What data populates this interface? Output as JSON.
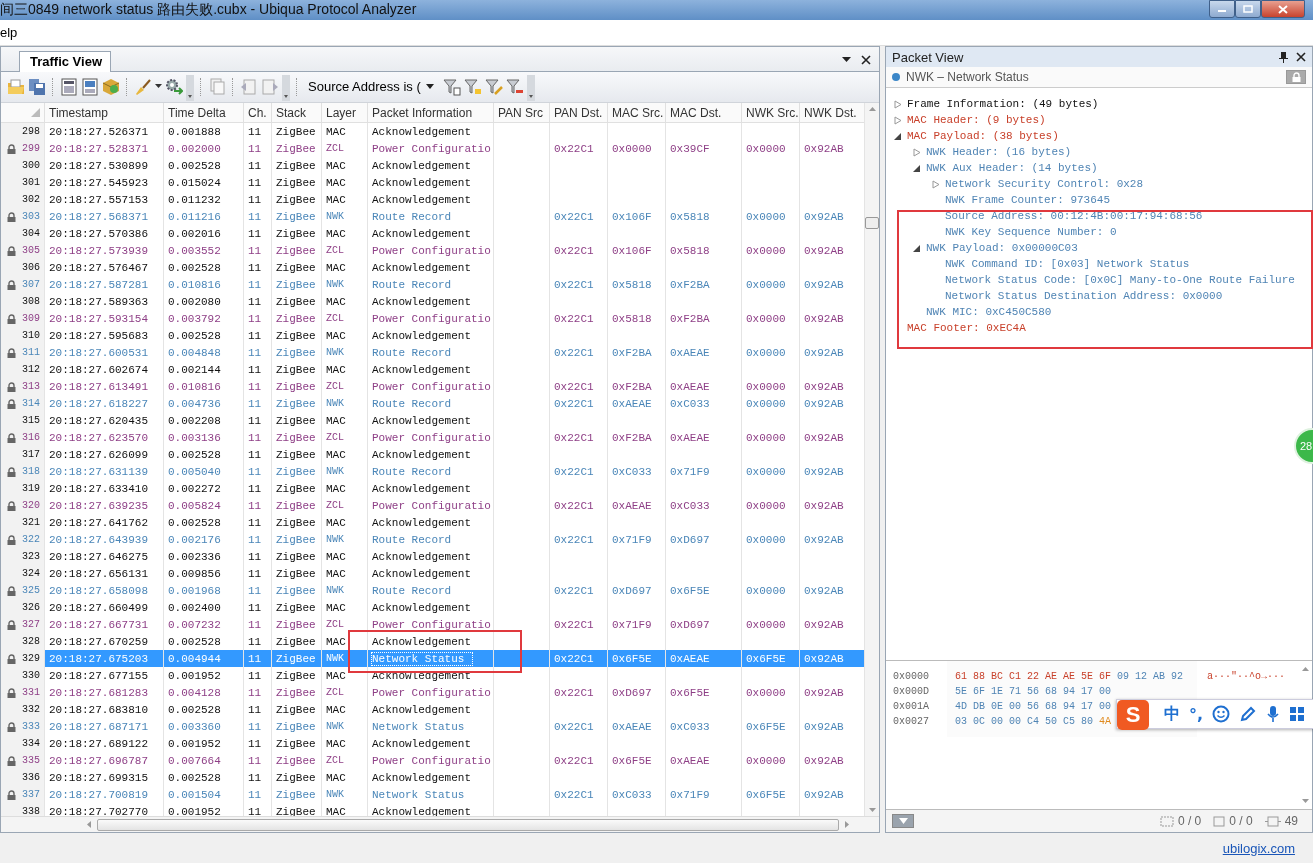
{
  "window": {
    "title": "间三0849 network status 路由失败.cubx - Ubiqua Protocol Analyzer"
  },
  "menu": [
    "elp"
  ],
  "traffic_view": {
    "tab": {
      "label": "Traffic View",
      "selected": true
    },
    "filter": "Source Address is (",
    "columns": [
      "Timestamp",
      "Time Delta",
      "Ch.",
      "Stack",
      "Layer",
      "Packet Information",
      "PAN Src",
      "PAN Dst.",
      "MAC Src.",
      "MAC Dst.",
      "NWK Src.",
      "NWK Dst."
    ],
    "rows": [
      {
        "n": "298",
        "timestamp": "20:18:27.526371",
        "time_delta": "0.001888",
        "ch": "11",
        "stack": "ZigBee",
        "layer": "MAC",
        "info": "Acknowledgement",
        "kind": "ack",
        "locked": false,
        "selected": false
      },
      {
        "n": "299",
        "timestamp": "20:18:27.528371",
        "time_delta": "0.002000",
        "ch": "11",
        "stack": "ZigBee",
        "layer": "ZCL",
        "info": "Power Configuratio",
        "pan_dst": "0x22C1",
        "mac_src": "0x0000",
        "mac_dst": "0x39CF",
        "nwk_src": "0x0000",
        "nwk_dst": "0x92AB",
        "kind": "zcl",
        "locked": true,
        "selected": false
      },
      {
        "n": "300",
        "timestamp": "20:18:27.530899",
        "time_delta": "0.002528",
        "ch": "11",
        "stack": "ZigBee",
        "layer": "MAC",
        "info": "Acknowledgement",
        "kind": "ack",
        "locked": false,
        "selected": false
      },
      {
        "n": "301",
        "timestamp": "20:18:27.545923",
        "time_delta": "0.015024",
        "ch": "11",
        "stack": "ZigBee",
        "layer": "MAC",
        "info": "Acknowledgement",
        "kind": "ack",
        "locked": false,
        "selected": false
      },
      {
        "n": "302",
        "timestamp": "20:18:27.557153",
        "time_delta": "0.011232",
        "ch": "11",
        "stack": "ZigBee",
        "layer": "MAC",
        "info": "Acknowledgement",
        "kind": "ack",
        "locked": false,
        "selected": false
      },
      {
        "n": "303",
        "timestamp": "20:18:27.568371",
        "time_delta": "0.011216",
        "ch": "11",
        "stack": "ZigBee",
        "layer": "NWK",
        "info": "Route Record",
        "pan_dst": "0x22C1",
        "mac_src": "0x106F",
        "mac_dst": "0x5818",
        "nwk_src": "0x0000",
        "nwk_dst": "0x92AB",
        "kind": "nwk",
        "locked": true,
        "selected": false
      },
      {
        "n": "304",
        "timestamp": "20:18:27.570386",
        "time_delta": "0.002016",
        "ch": "11",
        "stack": "ZigBee",
        "layer": "MAC",
        "info": "Acknowledgement",
        "kind": "ack",
        "locked": false,
        "selected": false
      },
      {
        "n": "305",
        "timestamp": "20:18:27.573939",
        "time_delta": "0.003552",
        "ch": "11",
        "stack": "ZigBee",
        "layer": "ZCL",
        "info": "Power Configuratio",
        "pan_dst": "0x22C1",
        "mac_src": "0x106F",
        "mac_dst": "0x5818",
        "nwk_src": "0x0000",
        "nwk_dst": "0x92AB",
        "kind": "zcl",
        "locked": true,
        "selected": false
      },
      {
        "n": "306",
        "timestamp": "20:18:27.576467",
        "time_delta": "0.002528",
        "ch": "11",
        "stack": "ZigBee",
        "layer": "MAC",
        "info": "Acknowledgement",
        "kind": "ack",
        "locked": false,
        "selected": false
      },
      {
        "n": "307",
        "timestamp": "20:18:27.587281",
        "time_delta": "0.010816",
        "ch": "11",
        "stack": "ZigBee",
        "layer": "NWK",
        "info": "Route Record",
        "pan_dst": "0x22C1",
        "mac_src": "0x5818",
        "mac_dst": "0xF2BA",
        "nwk_src": "0x0000",
        "nwk_dst": "0x92AB",
        "kind": "nwk",
        "locked": true,
        "selected": false
      },
      {
        "n": "308",
        "timestamp": "20:18:27.589363",
        "time_delta": "0.002080",
        "ch": "11",
        "stack": "ZigBee",
        "layer": "MAC",
        "info": "Acknowledgement",
        "kind": "ack",
        "locked": false,
        "selected": false
      },
      {
        "n": "309",
        "timestamp": "20:18:27.593154",
        "time_delta": "0.003792",
        "ch": "11",
        "stack": "ZigBee",
        "layer": "ZCL",
        "info": "Power Configuratio",
        "pan_dst": "0x22C1",
        "mac_src": "0x5818",
        "mac_dst": "0xF2BA",
        "nwk_src": "0x0000",
        "nwk_dst": "0x92AB",
        "kind": "zcl",
        "locked": true,
        "selected": false
      },
      {
        "n": "310",
        "timestamp": "20:18:27.595683",
        "time_delta": "0.002528",
        "ch": "11",
        "stack": "ZigBee",
        "layer": "MAC",
        "info": "Acknowledgement",
        "kind": "ack",
        "locked": false,
        "selected": false
      },
      {
        "n": "311",
        "timestamp": "20:18:27.600531",
        "time_delta": "0.004848",
        "ch": "11",
        "stack": "ZigBee",
        "layer": "NWK",
        "info": "Route Record",
        "pan_dst": "0x22C1",
        "mac_src": "0xF2BA",
        "mac_dst": "0xAEAE",
        "nwk_src": "0x0000",
        "nwk_dst": "0x92AB",
        "kind": "nwk",
        "locked": true,
        "selected": false
      },
      {
        "n": "312",
        "timestamp": "20:18:27.602674",
        "time_delta": "0.002144",
        "ch": "11",
        "stack": "ZigBee",
        "layer": "MAC",
        "info": "Acknowledgement",
        "kind": "ack",
        "locked": false,
        "selected": false
      },
      {
        "n": "313",
        "timestamp": "20:18:27.613491",
        "time_delta": "0.010816",
        "ch": "11",
        "stack": "ZigBee",
        "layer": "ZCL",
        "info": "Power Configuratio",
        "pan_dst": "0x22C1",
        "mac_src": "0xF2BA",
        "mac_dst": "0xAEAE",
        "nwk_src": "0x0000",
        "nwk_dst": "0x92AB",
        "kind": "zcl",
        "locked": true,
        "selected": false
      },
      {
        "n": "314",
        "timestamp": "20:18:27.618227",
        "time_delta": "0.004736",
        "ch": "11",
        "stack": "ZigBee",
        "layer": "NWK",
        "info": "Route Record",
        "pan_dst": "0x22C1",
        "mac_src": "0xAEAE",
        "mac_dst": "0xC033",
        "nwk_src": "0x0000",
        "nwk_dst": "0x92AB",
        "kind": "nwk",
        "locked": true,
        "selected": false
      },
      {
        "n": "315",
        "timestamp": "20:18:27.620435",
        "time_delta": "0.002208",
        "ch": "11",
        "stack": "ZigBee",
        "layer": "MAC",
        "info": "Acknowledgement",
        "kind": "ack",
        "locked": false,
        "selected": false
      },
      {
        "n": "316",
        "timestamp": "20:18:27.623570",
        "time_delta": "0.003136",
        "ch": "11",
        "stack": "ZigBee",
        "layer": "ZCL",
        "info": "Power Configuratio",
        "pan_dst": "0x22C1",
        "mac_src": "0xF2BA",
        "mac_dst": "0xAEAE",
        "nwk_src": "0x0000",
        "nwk_dst": "0x92AB",
        "kind": "zcl",
        "locked": true,
        "selected": false
      },
      {
        "n": "317",
        "timestamp": "20:18:27.626099",
        "time_delta": "0.002528",
        "ch": "11",
        "stack": "ZigBee",
        "layer": "MAC",
        "info": "Acknowledgement",
        "kind": "ack",
        "locked": false,
        "selected": false
      },
      {
        "n": "318",
        "timestamp": "20:18:27.631139",
        "time_delta": "0.005040",
        "ch": "11",
        "stack": "ZigBee",
        "layer": "NWK",
        "info": "Route Record",
        "pan_dst": "0x22C1",
        "mac_src": "0xC033",
        "mac_dst": "0x71F9",
        "nwk_src": "0x0000",
        "nwk_dst": "0x92AB",
        "kind": "nwk",
        "locked": true,
        "selected": false
      },
      {
        "n": "319",
        "timestamp": "20:18:27.633410",
        "time_delta": "0.002272",
        "ch": "11",
        "stack": "ZigBee",
        "layer": "MAC",
        "info": "Acknowledgement",
        "kind": "ack",
        "locked": false,
        "selected": false
      },
      {
        "n": "320",
        "timestamp": "20:18:27.639235",
        "time_delta": "0.005824",
        "ch": "11",
        "stack": "ZigBee",
        "layer": "ZCL",
        "info": "Power Configuratio",
        "pan_dst": "0x22C1",
        "mac_src": "0xAEAE",
        "mac_dst": "0xC033",
        "nwk_src": "0x0000",
        "nwk_dst": "0x92AB",
        "kind": "zcl",
        "locked": true,
        "selected": false
      },
      {
        "n": "321",
        "timestamp": "20:18:27.641762",
        "time_delta": "0.002528",
        "ch": "11",
        "stack": "ZigBee",
        "layer": "MAC",
        "info": "Acknowledgement",
        "kind": "ack",
        "locked": false,
        "selected": false
      },
      {
        "n": "322",
        "timestamp": "20:18:27.643939",
        "time_delta": "0.002176",
        "ch": "11",
        "stack": "ZigBee",
        "layer": "NWK",
        "info": "Route Record",
        "pan_dst": "0x22C1",
        "mac_src": "0x71F9",
        "mac_dst": "0xD697",
        "nwk_src": "0x0000",
        "nwk_dst": "0x92AB",
        "kind": "nwk",
        "locked": true,
        "selected": false
      },
      {
        "n": "323",
        "timestamp": "20:18:27.646275",
        "time_delta": "0.002336",
        "ch": "11",
        "stack": "ZigBee",
        "layer": "MAC",
        "info": "Acknowledgement",
        "kind": "ack",
        "locked": false,
        "selected": false
      },
      {
        "n": "324",
        "timestamp": "20:18:27.656131",
        "time_delta": "0.009856",
        "ch": "11",
        "stack": "ZigBee",
        "layer": "MAC",
        "info": "Acknowledgement",
        "kind": "ack",
        "locked": false,
        "selected": false
      },
      {
        "n": "325",
        "timestamp": "20:18:27.658098",
        "time_delta": "0.001968",
        "ch": "11",
        "stack": "ZigBee",
        "layer": "NWK",
        "info": "Route Record",
        "pan_dst": "0x22C1",
        "mac_src": "0xD697",
        "mac_dst": "0x6F5E",
        "nwk_src": "0x0000",
        "nwk_dst": "0x92AB",
        "kind": "nwk",
        "locked": true,
        "selected": false
      },
      {
        "n": "326",
        "timestamp": "20:18:27.660499",
        "time_delta": "0.002400",
        "ch": "11",
        "stack": "ZigBee",
        "layer": "MAC",
        "info": "Acknowledgement",
        "kind": "ack",
        "locked": false,
        "selected": false
      },
      {
        "n": "327",
        "timestamp": "20:18:27.667731",
        "time_delta": "0.007232",
        "ch": "11",
        "stack": "ZigBee",
        "layer": "ZCL",
        "info": "Power Configuratio",
        "pan_dst": "0x22C1",
        "mac_src": "0x71F9",
        "mac_dst": "0xD697",
        "nwk_src": "0x0000",
        "nwk_dst": "0x92AB",
        "kind": "zcl",
        "locked": true,
        "selected": false
      },
      {
        "n": "328",
        "timestamp": "20:18:27.670259",
        "time_delta": "0.002528",
        "ch": "11",
        "stack": "ZigBee",
        "layer": "MAC",
        "info": "Acknowledgement",
        "kind": "ack",
        "locked": false,
        "selected": false
      },
      {
        "n": "329",
        "timestamp": "20:18:27.675203",
        "time_delta": "0.004944",
        "ch": "11",
        "stack": "ZigBee",
        "layer": "NWK",
        "info": "Network Status",
        "pan_dst": "0x22C1",
        "mac_src": "0x6F5E",
        "mac_dst": "0xAEAE",
        "nwk_src": "0x6F5E",
        "nwk_dst": "0x92AB",
        "kind": "nwk",
        "locked": true,
        "selected": true
      },
      {
        "n": "330",
        "timestamp": "20:18:27.677155",
        "time_delta": "0.001952",
        "ch": "11",
        "stack": "ZigBee",
        "layer": "MAC",
        "info": "Acknowledgement",
        "kind": "ack",
        "locked": false,
        "selected": false
      },
      {
        "n": "331",
        "timestamp": "20:18:27.681283",
        "time_delta": "0.004128",
        "ch": "11",
        "stack": "ZigBee",
        "layer": "ZCL",
        "info": "Power Configuratio",
        "pan_dst": "0x22C1",
        "mac_src": "0xD697",
        "mac_dst": "0x6F5E",
        "nwk_src": "0x0000",
        "nwk_dst": "0x92AB",
        "kind": "zcl",
        "locked": true,
        "selected": false
      },
      {
        "n": "332",
        "timestamp": "20:18:27.683810",
        "time_delta": "0.002528",
        "ch": "11",
        "stack": "ZigBee",
        "layer": "MAC",
        "info": "Acknowledgement",
        "kind": "ack",
        "locked": false,
        "selected": false
      },
      {
        "n": "333",
        "timestamp": "20:18:27.687171",
        "time_delta": "0.003360",
        "ch": "11",
        "stack": "ZigBee",
        "layer": "NWK",
        "info": "Network Status",
        "pan_dst": "0x22C1",
        "mac_src": "0xAEAE",
        "mac_dst": "0xC033",
        "nwk_src": "0x6F5E",
        "nwk_dst": "0x92AB",
        "kind": "nwk",
        "locked": true,
        "selected": false
      },
      {
        "n": "334",
        "timestamp": "20:18:27.689122",
        "time_delta": "0.001952",
        "ch": "11",
        "stack": "ZigBee",
        "layer": "MAC",
        "info": "Acknowledgement",
        "kind": "ack",
        "locked": false,
        "selected": false
      },
      {
        "n": "335",
        "timestamp": "20:18:27.696787",
        "time_delta": "0.007664",
        "ch": "11",
        "stack": "ZigBee",
        "layer": "ZCL",
        "info": "Power Configuratio",
        "pan_dst": "0x22C1",
        "mac_src": "0x6F5E",
        "mac_dst": "0xAEAE",
        "nwk_src": "0x0000",
        "nwk_dst": "0x92AB",
        "kind": "zcl",
        "locked": true,
        "selected": false
      },
      {
        "n": "336",
        "timestamp": "20:18:27.699315",
        "time_delta": "0.002528",
        "ch": "11",
        "stack": "ZigBee",
        "layer": "MAC",
        "info": "Acknowledgement",
        "kind": "ack",
        "locked": false,
        "selected": false
      },
      {
        "n": "337",
        "timestamp": "20:18:27.700819",
        "time_delta": "0.001504",
        "ch": "11",
        "stack": "ZigBee",
        "layer": "NWK",
        "info": "Network Status",
        "pan_dst": "0x22C1",
        "mac_src": "0xC033",
        "mac_dst": "0x71F9",
        "nwk_src": "0x6F5E",
        "nwk_dst": "0x92AB",
        "kind": "nwk",
        "locked": true,
        "selected": false
      },
      {
        "n": "338",
        "timestamp": "20:18:27.702770",
        "time_delta": "0.001952",
        "ch": "11",
        "stack": "ZigBee",
        "layer": "MAC",
        "info": "Acknowledgement",
        "kind": "ack",
        "locked": false,
        "selected": false
      }
    ]
  },
  "packet_view": {
    "title": "Packet View",
    "subtitle": "NWK – Network Status",
    "tree": [
      {
        "text": "Frame Information: (49 bytes)",
        "kind": "frame",
        "expanded": false
      },
      {
        "text": "MAC Header: (9 bytes)",
        "kind": "mac",
        "expanded": false
      },
      {
        "text": "MAC Payload: (38 bytes)",
        "kind": "mac",
        "expanded": true,
        "children": [
          {
            "text": "NWK Header: (16 bytes)",
            "kind": "nwk",
            "expanded": false
          },
          {
            "text": "NWK Aux Header: (14 bytes)",
            "kind": "nwk",
            "expanded": true,
            "children": [
              {
                "text": "Network Security Control: 0x28",
                "kind": "nwk",
                "expanded": false
              },
              {
                "text": "NWK Frame Counter: 973645",
                "kind": "nwk"
              },
              {
                "text": "Source Address: 00:12:4B:00:17:94:68:56",
                "kind": "nwk"
              },
              {
                "text": "NWK Key Sequence Number: 0",
                "kind": "nwk"
              }
            ]
          },
          {
            "text": "NWK Payload: 0x00000C03",
            "kind": "nwk",
            "expanded": true,
            "children": [
              {
                "text": "NWK Command ID: [0x03] Network Status",
                "kind": "nwk"
              },
              {
                "text": "Network Status Code: [0x0C] Many-to-One Route Failure",
                "kind": "nwk"
              },
              {
                "text": "Network Status Destination Address: 0x0000",
                "kind": "nwk"
              }
            ]
          },
          {
            "text": "NWK MIC: 0xC450C580",
            "kind": "nwk"
          }
        ]
      },
      {
        "text": "MAC Footer: 0xEC4A",
        "kind": "mac"
      }
    ],
    "hex": [
      {
        "offset": "0x0000",
        "groups": [
          {
            "text": "61 88 BC C1 22 AE AE 5E 6F",
            "kind": "mac"
          },
          {
            "text": "09 12 AB 92",
            "kind": "nwk"
          }
        ],
        "ascii": "a···\"··^o→···"
      },
      {
        "offset": "0x000D",
        "groups": [
          {
            "text": "5E 6F 1E 71 56 68 94 17 00",
            "kind": "nwk"
          }
        ]
      },
      {
        "offset": "0x001A",
        "groups": [
          {
            "text": "4D DB 0E 00 56 68 94 17 00",
            "kind": "nwk"
          }
        ]
      },
      {
        "offset": "0x0027",
        "groups": [
          {
            "text": "03 0C 00 00 C4 50 C5 80",
            "kind": "nwk"
          },
          {
            "text": "4A",
            "kind": "footer"
          }
        ]
      }
    ],
    "counters": [
      "0 / 0",
      "0 / 0",
      "49"
    ]
  },
  "ime_toolbar": {
    "logo": "S",
    "mode": "中",
    "punctuation": "°,"
  },
  "floating_badge": "28",
  "footer": {
    "link": "ubilogix.com"
  }
}
